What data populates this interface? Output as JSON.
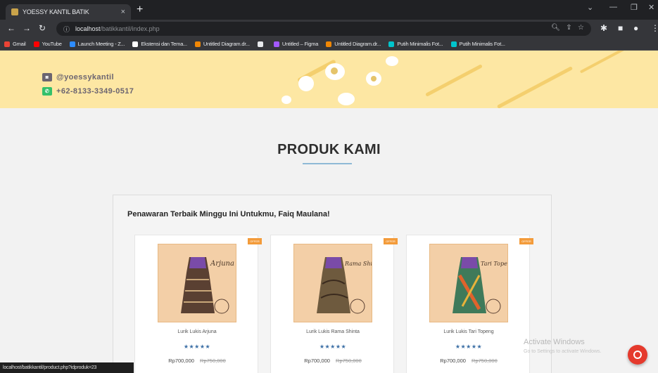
{
  "browser": {
    "tab_title": "YOESSY KANTIL BATIK",
    "tab_close": "×",
    "new_tab": "+",
    "url_host": "localhost",
    "url_path": "/batikkantil/index.php",
    "status_url": "localhost/batikkantil/product.php?idproduk=23"
  },
  "bookmarks": [
    {
      "label": "Gmail",
      "color": "#ea4335"
    },
    {
      "label": "YouTube",
      "color": "#ff0000"
    },
    {
      "label": "Launch Meeting - Z...",
      "color": "#2d8cff"
    },
    {
      "label": "Ekstensi dan Tema...",
      "color": "#ffffff"
    },
    {
      "label": "Untitled Diagram.dr...",
      "color": "#f08705"
    },
    {
      "label": "",
      "color": "#e8eaed"
    },
    {
      "label": "Untitled – Figma",
      "color": "#a259ff"
    },
    {
      "label": "Untitled Diagram.dr...",
      "color": "#f08705"
    },
    {
      "label": "Putih Minimalis Fot...",
      "color": "#00c4cc"
    },
    {
      "label": "Putih Minimalis Fot...",
      "color": "#00c4cc"
    }
  ],
  "hero": {
    "instagram": "@yoessykantil",
    "whatsapp": "+62-8133-3349-0517"
  },
  "section": {
    "heading": "PRODUK KAMI",
    "offer_title": "Penawaran Terbaik Minggu Ini Untukmu, Faiq Maulana!"
  },
  "products": [
    {
      "name": "Lurik Lukis Arjuna",
      "rating": "★★★★★",
      "price": "Rp700,000",
      "old_price": "Rp750,000",
      "badge": "OFFER",
      "img_caption": "Arjuna"
    },
    {
      "name": "Lurik Lukis Rama Shinta",
      "rating": "★★★★★",
      "price": "Rp700,000",
      "old_price": "Rp750,000",
      "badge": "OFFER",
      "img_caption": "Rama Shinta"
    },
    {
      "name": "Lurik Lukis Tari Topeng",
      "rating": "★★★★★",
      "price": "Rp700,000",
      "old_price": "Rp750,000",
      "badge": "OFFER",
      "img_caption": "Tari Topeng"
    }
  ],
  "watermark": {
    "title": "Activate Windows",
    "subtitle": "Go to Settings to activate Windows."
  },
  "colors": {
    "hero_bg": "#fde7a3",
    "accent_blue": "#3d8ecf",
    "badge_orange": "#f39b3a",
    "fab_red": "#e53a2d"
  }
}
